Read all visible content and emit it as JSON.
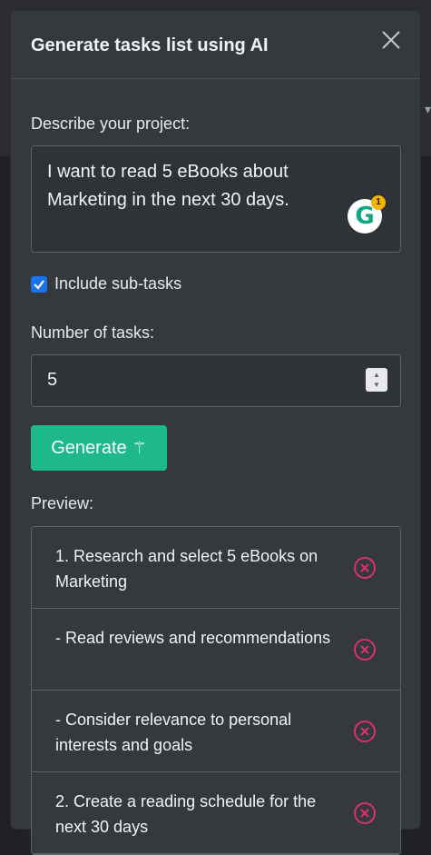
{
  "modal": {
    "title": "Generate tasks list using AI",
    "description_label": "Describe your project:",
    "description_value": "I want to read 5 eBooks about Marketing in the next 30 days.",
    "grammarly_badge": "1",
    "include_subtasks_label": "Include sub-tasks",
    "include_subtasks_checked": true,
    "num_tasks_label": "Number of tasks:",
    "num_tasks_value": "5",
    "generate_label": "Generate",
    "preview_label": "Preview:",
    "preview_items": [
      {
        "text": "1. Research and select 5 eBooks on Marketing"
      },
      {
        "text": "- Read reviews and recommendations"
      },
      {
        "text": "- Consider relevance to personal interests and goals"
      },
      {
        "text": "2. Create a reading schedule for the next 30 days"
      }
    ]
  },
  "icons": {
    "close": "close-icon",
    "check": "checkmark-icon",
    "grammarly": "grammarly-icon",
    "stepper": "stepper-icon",
    "wand": "magic-wand-icon",
    "remove": "remove-circle-icon"
  },
  "colors": {
    "modal_bg": "#35383d",
    "primary_button": "#1db98a",
    "checkbox": "#1a73e8",
    "remove_icon": "#d6336c"
  }
}
